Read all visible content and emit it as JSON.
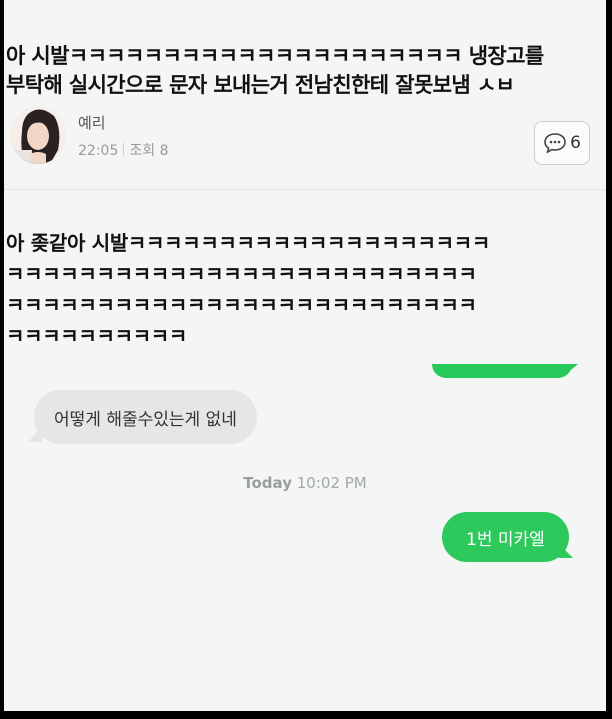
{
  "post": {
    "title": "아 시발ㅋㅋㅋㅋㅋㅋㅋㅋㅋㅋㅋㅋㅋㅋㅋㅋㅋㅋㅋㅋㅋ 냉장고를\n부탁해 실시간으로 문자 보내는거 전남친한테 잘못보냄 ㅅㅂ",
    "author": "예리",
    "time": "22:05",
    "views": "조회 8",
    "comment_count": "6",
    "body": "아 좆같아 시발ㅋㅋㅋㅋㅋㅋㅋㅋㅋㅋㅋㅋㅋㅋㅋㅋㅋㅋㅋㅋ\nㅋㅋㅋㅋㅋㅋㅋㅋㅋㅋㅋㅋㅋㅋㅋㅋㅋㅋㅋㅋㅋㅋㅋㅋㅋㅋ\nㅋㅋㅋㅋㅋㅋㅋㅋㅋㅋㅋㅋㅋㅋㅋㅋㅋㅋㅋㅋㅋㅋㅋㅋㅋㅋ\nㅋㅋㅋㅋㅋㅋㅋㅋㅋㅋ"
  },
  "chat": {
    "incoming_message": "어떻게 해줄수있는게 없네",
    "timestamp_day": "Today",
    "timestamp_time": "10:02 PM",
    "outgoing_message": "1번 미카엘"
  },
  "colors": {
    "sent_bubble": "#2ec95c",
    "received_bubble": "#e4e7e6",
    "background": "#f3f6f4"
  },
  "icons": {
    "comment": "speech-bubble-dots-icon",
    "avatar": "profile-photo"
  }
}
